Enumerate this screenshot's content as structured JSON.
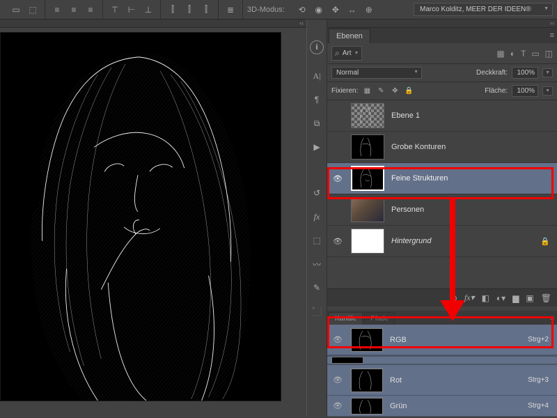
{
  "topbar": {
    "mode_label": "3D-Modus:",
    "profile": "Marco Kolditz, MEER DER IDEEN®"
  },
  "layers_panel": {
    "tab_label": "Ebenen",
    "search_kind": "Art",
    "blend_mode": "Normal",
    "opacity_label": "Deckkraft:",
    "opacity_value": "100%",
    "lock_label": "Fixieren:",
    "fill_label": "Fläche:",
    "fill_value": "100%",
    "layers": [
      {
        "name": "Ebene 1",
        "visible": false,
        "thumb": "checker-sketch"
      },
      {
        "name": "Grobe Konturen",
        "visible": false,
        "thumb": "sketch"
      },
      {
        "name": "Feine Strukturen",
        "visible": true,
        "thumb": "sketch",
        "selected": true
      },
      {
        "name": "Personen",
        "visible": false,
        "thumb": "photo"
      },
      {
        "name": "Hintergrund",
        "visible": true,
        "thumb": "white",
        "locked": true,
        "italic": true
      }
    ]
  },
  "channels_panel": {
    "tab1": "Kanäle",
    "tab2": "Pfade",
    "channels": [
      {
        "name": "RGB",
        "shortcut": "Strg+2",
        "visible": true
      },
      {
        "name": "Rot",
        "shortcut": "Strg+3",
        "visible": true
      },
      {
        "name": "Grün",
        "shortcut": "Strg+4",
        "visible": true
      }
    ]
  }
}
